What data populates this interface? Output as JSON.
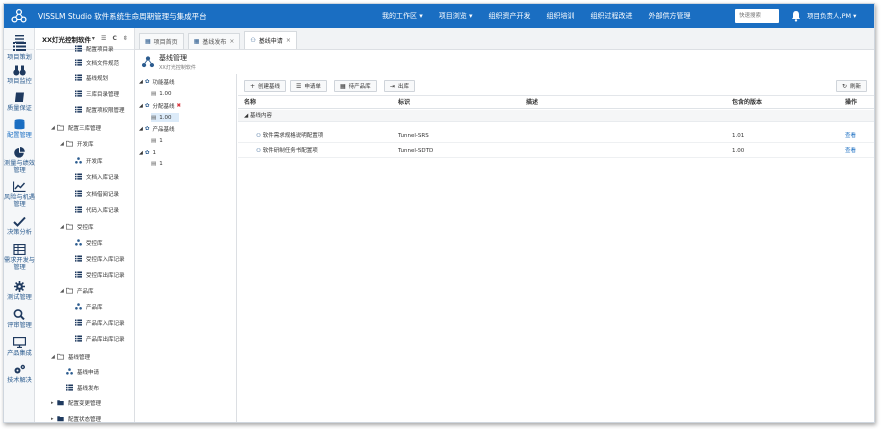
{
  "app": {
    "title": "VISSLM Studio 软件系统生命周期管理与集成平台",
    "top_nav": [
      "我的工作区 ▾",
      "项目浏览 ▾",
      "组织资产开发",
      "组织培训",
      "组织过程改进",
      "外部供方管理"
    ],
    "search_placeholder": "快速搜索",
    "user": "项目负责人,PM ▾"
  },
  "sidenav": [
    {
      "label": "项目策划",
      "icon": "list-icon"
    },
    {
      "label": "项目监控",
      "icon": "binoculars-icon"
    },
    {
      "label": "质量保证",
      "icon": "book-icon"
    },
    {
      "label": "配置管理",
      "icon": "database-icon"
    },
    {
      "label": "测量与绩效管理",
      "icon": "pie-chart-icon"
    },
    {
      "label": "风险与机遇管理",
      "icon": "line-chart-icon"
    },
    {
      "label": "决策分析",
      "icon": "check-icon"
    },
    {
      "label": "需求开发与管理",
      "icon": "table-icon"
    },
    {
      "label": "测试管理",
      "icon": "gear-icon"
    },
    {
      "label": "评审管理",
      "icon": "search-icon"
    },
    {
      "label": "产品集成",
      "icon": "monitor-icon"
    },
    {
      "label": "技术解决",
      "icon": "cogs-icon"
    }
  ],
  "tree": {
    "title": "XX灯光控制软件",
    "tools": "▾ ☰ C ⇳",
    "nodes": [
      {
        "label": "配置项目录",
        "indent": 3,
        "icon": "list"
      },
      {
        "label": "文档文件规范",
        "indent": 3,
        "icon": "list"
      },
      {
        "label": "基线规划",
        "indent": 3,
        "icon": "list"
      },
      {
        "label": "三库目录管理",
        "indent": 3,
        "icon": "list"
      },
      {
        "label": "配置项权限管理",
        "indent": 3,
        "icon": "list"
      },
      {
        "label": "配置三库管理",
        "indent": 1,
        "icon": "folder",
        "toggle": "◢"
      },
      {
        "label": "开发库",
        "indent": 2,
        "icon": "folder",
        "toggle": "◢"
      },
      {
        "label": "开发库",
        "indent": 3,
        "icon": "share"
      },
      {
        "label": "文档入库记录",
        "indent": 3,
        "icon": "list"
      },
      {
        "label": "文档借阅记录",
        "indent": 3,
        "icon": "list"
      },
      {
        "label": "代码入库记录",
        "indent": 3,
        "icon": "list"
      },
      {
        "label": "受控库",
        "indent": 2,
        "icon": "folder",
        "toggle": "◢"
      },
      {
        "label": "受控库",
        "indent": 3,
        "icon": "share"
      },
      {
        "label": "受控库入库记录",
        "indent": 3,
        "icon": "list"
      },
      {
        "label": "受控库出库记录",
        "indent": 3,
        "icon": "list"
      },
      {
        "label": "产品库",
        "indent": 2,
        "icon": "folder",
        "toggle": "◢"
      },
      {
        "label": "产品库",
        "indent": 3,
        "icon": "share"
      },
      {
        "label": "产品库入库记录",
        "indent": 3,
        "icon": "list"
      },
      {
        "label": "产品库出库记录",
        "indent": 3,
        "icon": "list"
      },
      {
        "label": "基线管理",
        "indent": 1,
        "icon": "folder",
        "toggle": "◢"
      },
      {
        "label": "基线申请",
        "indent": 2,
        "icon": "share"
      },
      {
        "label": "基线发布",
        "indent": 2,
        "icon": "list"
      },
      {
        "label": "配置变更管理",
        "indent": 1,
        "icon": "folder-closed",
        "toggle": "▸"
      },
      {
        "label": "配置状态管理",
        "indent": 1,
        "icon": "folder-closed",
        "toggle": "▸"
      }
    ]
  },
  "tabs": [
    {
      "label": "项目首页",
      "close": ""
    },
    {
      "label": "基线发布",
      "close": "×"
    },
    {
      "label": "基线申请",
      "close": "×"
    }
  ],
  "page_head": {
    "title": "基线管理",
    "subtitle": "XX灯光控制软件"
  },
  "baselines": [
    {
      "label": "功能基线",
      "indent": 0,
      "type": "group"
    },
    {
      "label": "1.00",
      "indent": 1,
      "type": "item"
    },
    {
      "label": "分配基线",
      "indent": 0,
      "type": "group",
      "mark": "✖"
    },
    {
      "label": "1.00",
      "indent": 1,
      "type": "item",
      "selected": true
    },
    {
      "label": "产品基线",
      "indent": 0,
      "type": "group"
    },
    {
      "label": "1",
      "indent": 1,
      "type": "item"
    },
    {
      "label": "1",
      "indent": 0,
      "type": "group"
    },
    {
      "label": "1",
      "indent": 1,
      "type": "item"
    }
  ],
  "toolbar": {
    "create": "创建基线",
    "apply": "申请单",
    "gen": "待产品库",
    "export": "出库",
    "refresh": "刷新"
  },
  "grid": {
    "columns": [
      "名称",
      "标识",
      "描述",
      "包含的版本",
      "操作"
    ],
    "group_label": "◢ 基线内容",
    "rows": [
      {
        "name": "软件需求规格说明配置项",
        "id": "Tunnel-SRS",
        "desc": "",
        "version": "1.01",
        "action": "查看"
      },
      {
        "name": "软件研制任务书配置项",
        "id": "Tunnel-SDTD",
        "desc": "",
        "version": "1.00",
        "action": "查看"
      }
    ]
  }
}
